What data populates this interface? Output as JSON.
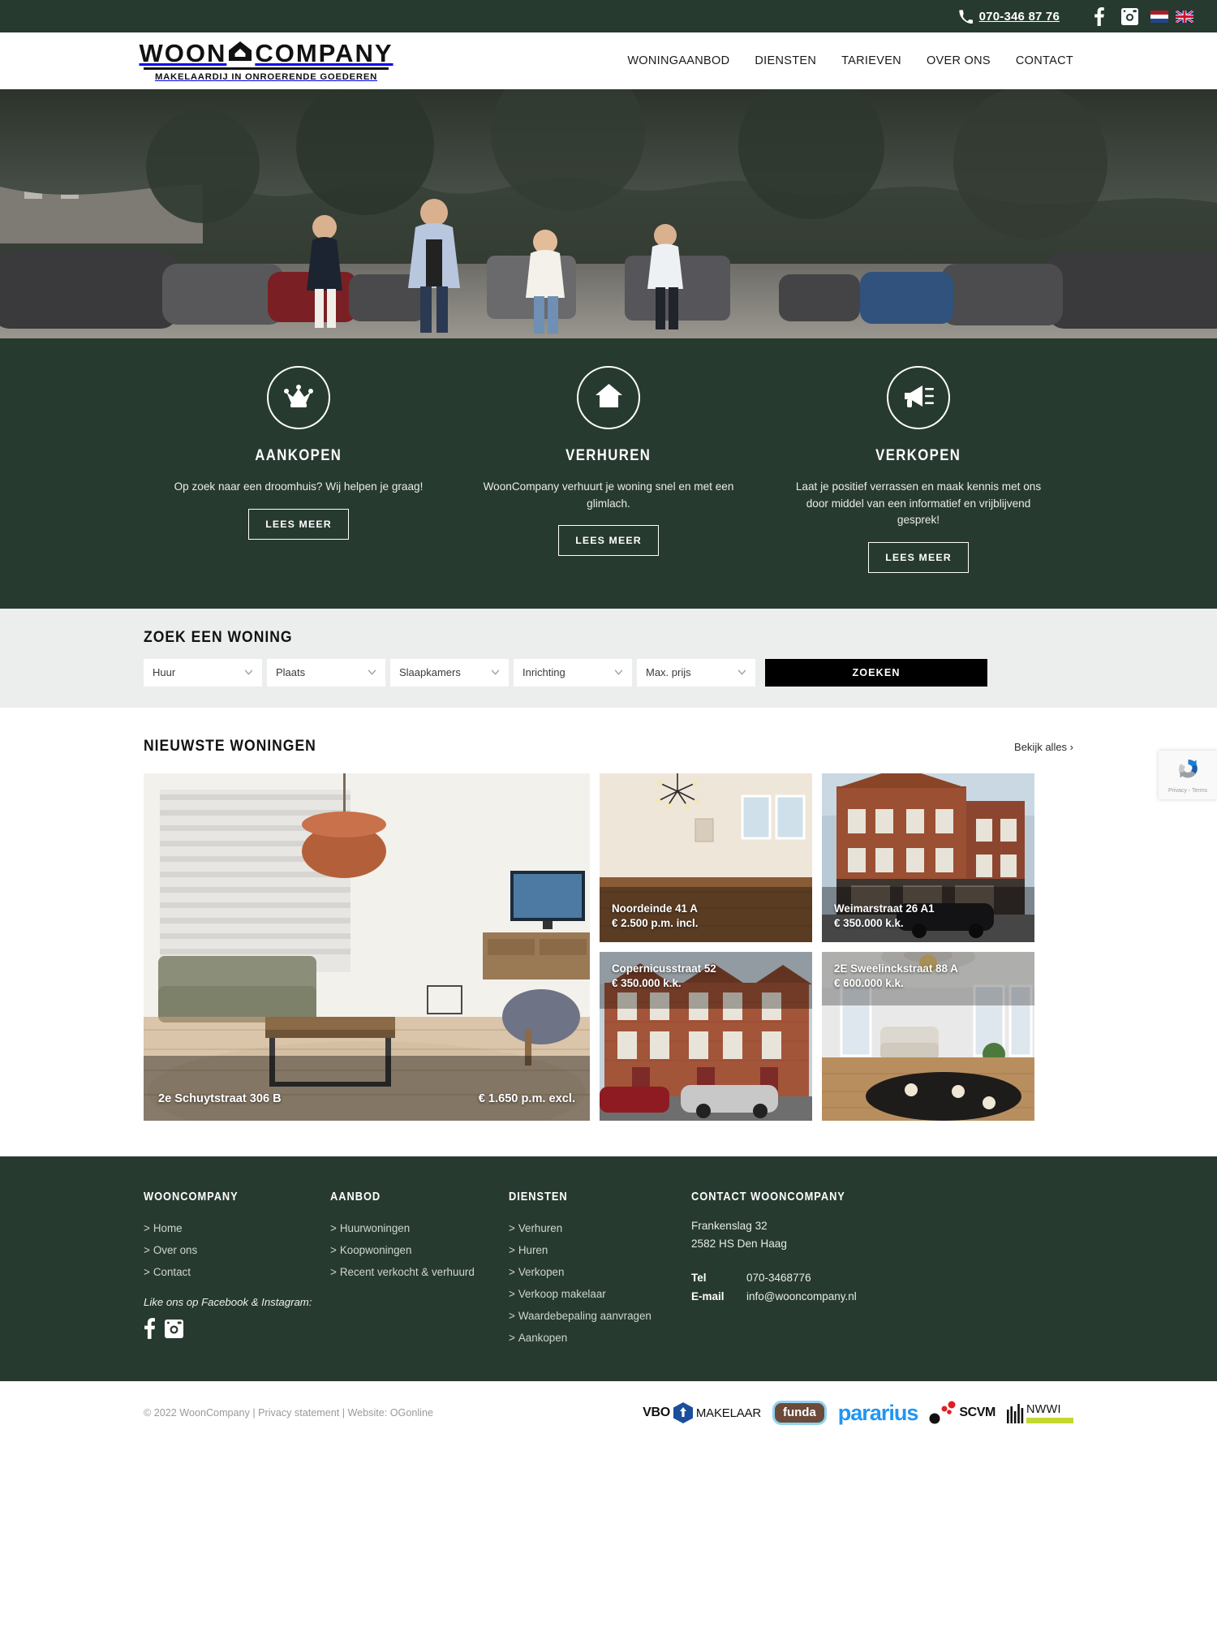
{
  "topbar": {
    "phone": "070-346 87 76",
    "phone_icon": "phone-icon",
    "facebook_icon": "facebook-icon",
    "instagram_icon": "instagram-icon",
    "lang_nl": "nl-flag-icon",
    "lang_en": "en-flag-icon"
  },
  "logo": {
    "word1": "WOON",
    "word2": "COMPANY",
    "mark": "house-icon",
    "tagline": "MAKELAARDIJ IN ONROERENDE GOEDEREN"
  },
  "nav": {
    "items": [
      {
        "label": "WONINGAANBOD"
      },
      {
        "label": "DIENSTEN"
      },
      {
        "label": "TARIEVEN"
      },
      {
        "label": "OVER ONS"
      },
      {
        "label": "CONTACT"
      }
    ]
  },
  "hero": {
    "alt": "Vier makelaars lopen over een straat met geparkeerde auto's en bomen"
  },
  "services": {
    "items": [
      {
        "icon": "crown-icon",
        "title": "AANKOPEN",
        "text": "Op zoek naar een droomhuis? Wij helpen je graag!",
        "button": "LEES MEER"
      },
      {
        "icon": "home-icon",
        "title": "VERHUREN",
        "text": "WoonCompany verhuurt je woning snel en met een glimlach.",
        "button": "LEES MEER"
      },
      {
        "icon": "megaphone-icon",
        "title": "VERKOPEN",
        "text": "Laat je positief verrassen en maak kennis met ons door middel van een informatief en vrijblijvend gesprek!",
        "button": "LEES MEER"
      }
    ]
  },
  "search": {
    "title": "ZOEK EEN WONING",
    "fields": [
      {
        "value": "Huur"
      },
      {
        "value": "Plaats"
      },
      {
        "value": "Slaapkamers"
      },
      {
        "value": "Inrichting"
      },
      {
        "value": "Max. prijs"
      }
    ],
    "submit": "ZOEKEN"
  },
  "recaptcha": {
    "terms": "Privacy - Terms"
  },
  "listings": {
    "title": "NIEUWSTE WONINGEN",
    "view_all": "Bekijk alles ›",
    "items": [
      {
        "address": "2e Schuytstraat 306 B",
        "price": "€ 1.650 p.m. excl.",
        "photo": "living-room-with-sofa-and-tv"
      },
      {
        "address": "Noordeinde 41 A",
        "price": "€ 2.500 p.m. incl.",
        "photo": "empty-room-with-wooden-floor"
      },
      {
        "address": "Weimarstraat 26 A1",
        "price": "€ 350.000 k.k.",
        "photo": "brick-facade-street-view"
      },
      {
        "address": "Copernicusstraat 52",
        "price": "€ 350.000 k.k.",
        "photo": "brick-apartment-building"
      },
      {
        "address": "2E Sweelinckstraat 88 A",
        "price": "€ 600.000 k.k.",
        "photo": "bright-living-room-with-windows"
      }
    ]
  },
  "footer": {
    "col1": {
      "title": "WOONCOMPANY",
      "links": [
        {
          "label": "Home"
        },
        {
          "label": "Over ons"
        },
        {
          "label": "Contact"
        }
      ],
      "like_text": "Like ons op Facebook & Instagram:",
      "facebook_icon": "facebook-icon",
      "instagram_icon": "instagram-icon"
    },
    "col2": {
      "title": "AANBOD",
      "links": [
        {
          "label": "Huurwoningen"
        },
        {
          "label": "Koopwoningen"
        },
        {
          "label": "Recent verkocht & verhuurd"
        }
      ]
    },
    "col3": {
      "title": "DIENSTEN",
      "links": [
        {
          "label": "Verhuren"
        },
        {
          "label": "Huren"
        },
        {
          "label": "Verkopen"
        },
        {
          "label": "Verkoop makelaar"
        },
        {
          "label": "Waardebepaling aanvragen"
        },
        {
          "label": "Aankopen"
        }
      ]
    },
    "col4": {
      "title": "CONTACT WOONCOMPANY",
      "address_line1": "Frankenslag 32",
      "address_line2": "2582 HS Den Haag",
      "tel_label": "Tel",
      "tel_value": "070-3468776",
      "email_label": "E-mail",
      "email_value": "info@wooncompany.nl"
    }
  },
  "bottom": {
    "copyright": "© 2022 WoonCompany | Privacy statement | Website: OGonline",
    "partners": [
      {
        "name": "VBO MAKELAAR",
        "vbo": "VBO",
        "makelaar": "MAKELAAR"
      },
      {
        "name": "funda",
        "label": "funda"
      },
      {
        "name": "pararius",
        "label": "pararius"
      },
      {
        "name": "SCVM",
        "label": "SCVM"
      },
      {
        "name": "NWWI",
        "label": "NWWI"
      }
    ]
  },
  "colors": {
    "brand_green": "#273a30",
    "search_band": "#eceded",
    "accent_black": "#000000",
    "pararius_blue": "#2196f3",
    "nwwi_green": "#c4d82e"
  }
}
